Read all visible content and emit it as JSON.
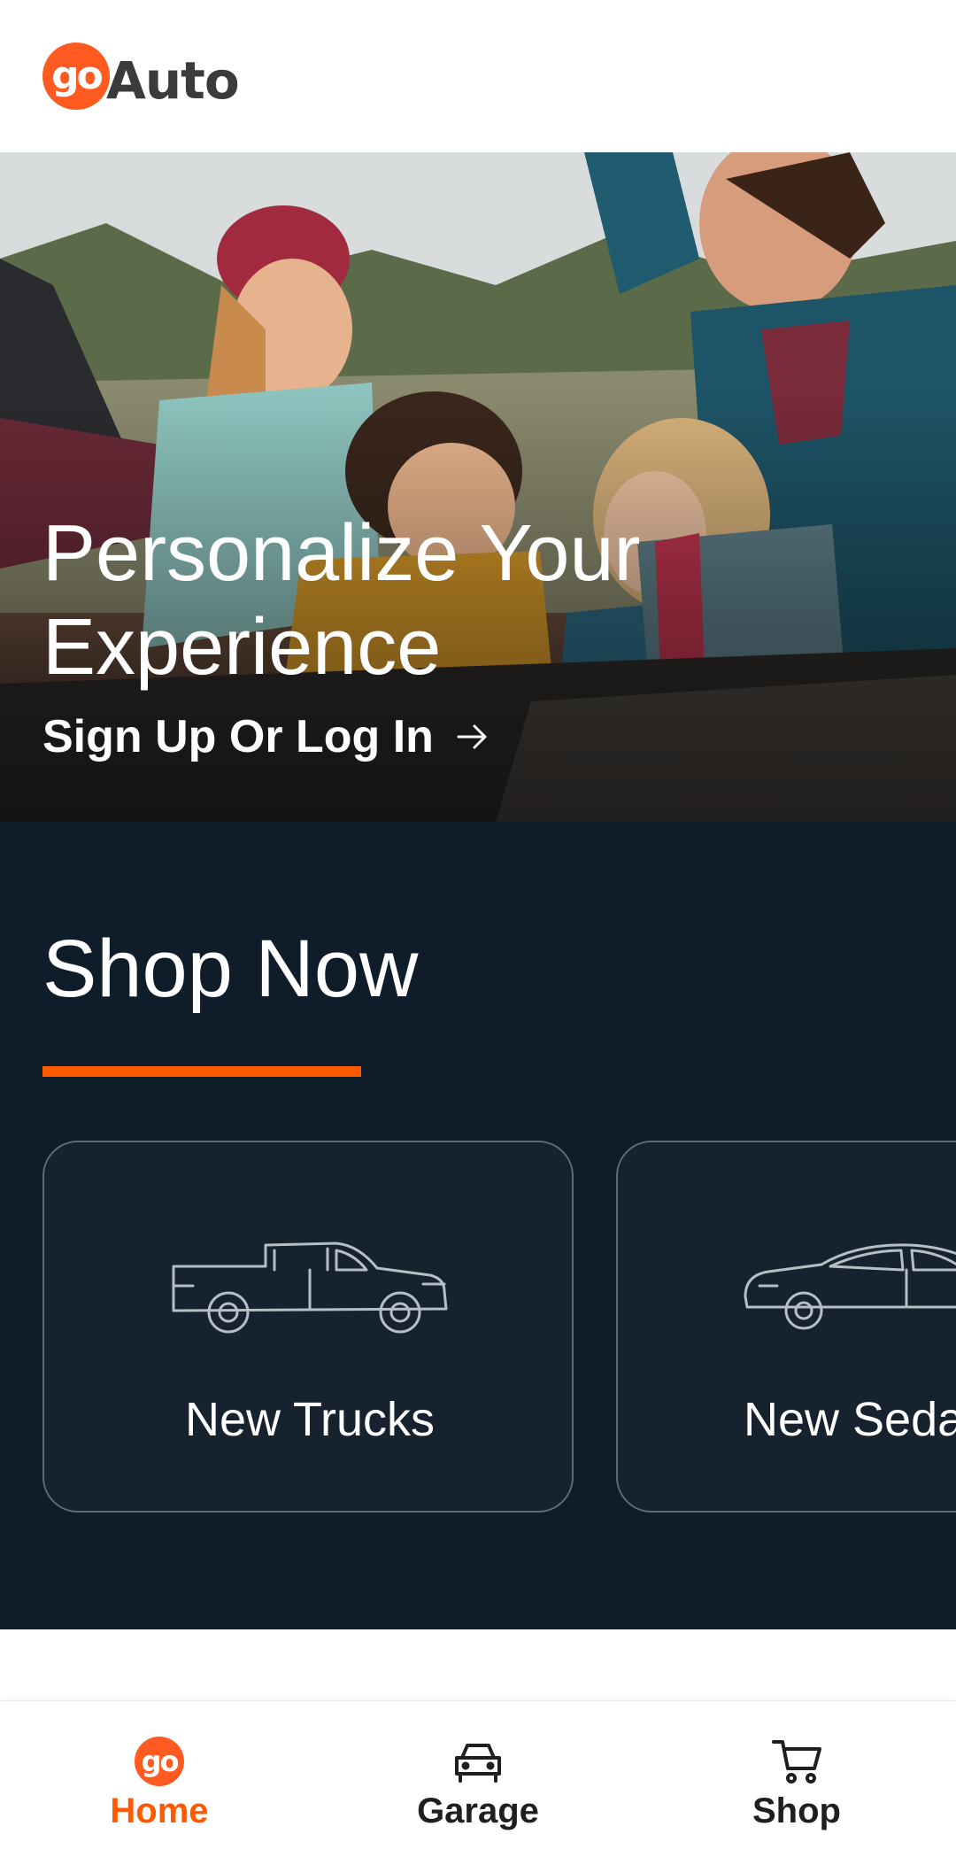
{
  "header": {
    "logo_mark": "go",
    "logo_word": "Auto"
  },
  "hero": {
    "title": "Personalize Your Experience",
    "link_label": "Sign Up Or Log In",
    "image": "family-camping-photo"
  },
  "shop": {
    "title": "Shop Now",
    "cards": [
      {
        "label": "New Trucks",
        "icon": "pickup-truck-icon"
      },
      {
        "label": "New Sedans",
        "icon": "sedan-icon"
      }
    ]
  },
  "bottom_nav": {
    "items": [
      {
        "label": "Home",
        "icon": "go-logo-icon",
        "active": true
      },
      {
        "label": "Garage",
        "icon": "car-front-icon",
        "active": false
      },
      {
        "label": "Shop",
        "icon": "cart-icon",
        "active": false
      }
    ]
  },
  "colors": {
    "brand_orange": "#ff5a00",
    "navy": "#0f1d2a",
    "card_bg": "#16232f",
    "card_border": "#5d6b78"
  }
}
